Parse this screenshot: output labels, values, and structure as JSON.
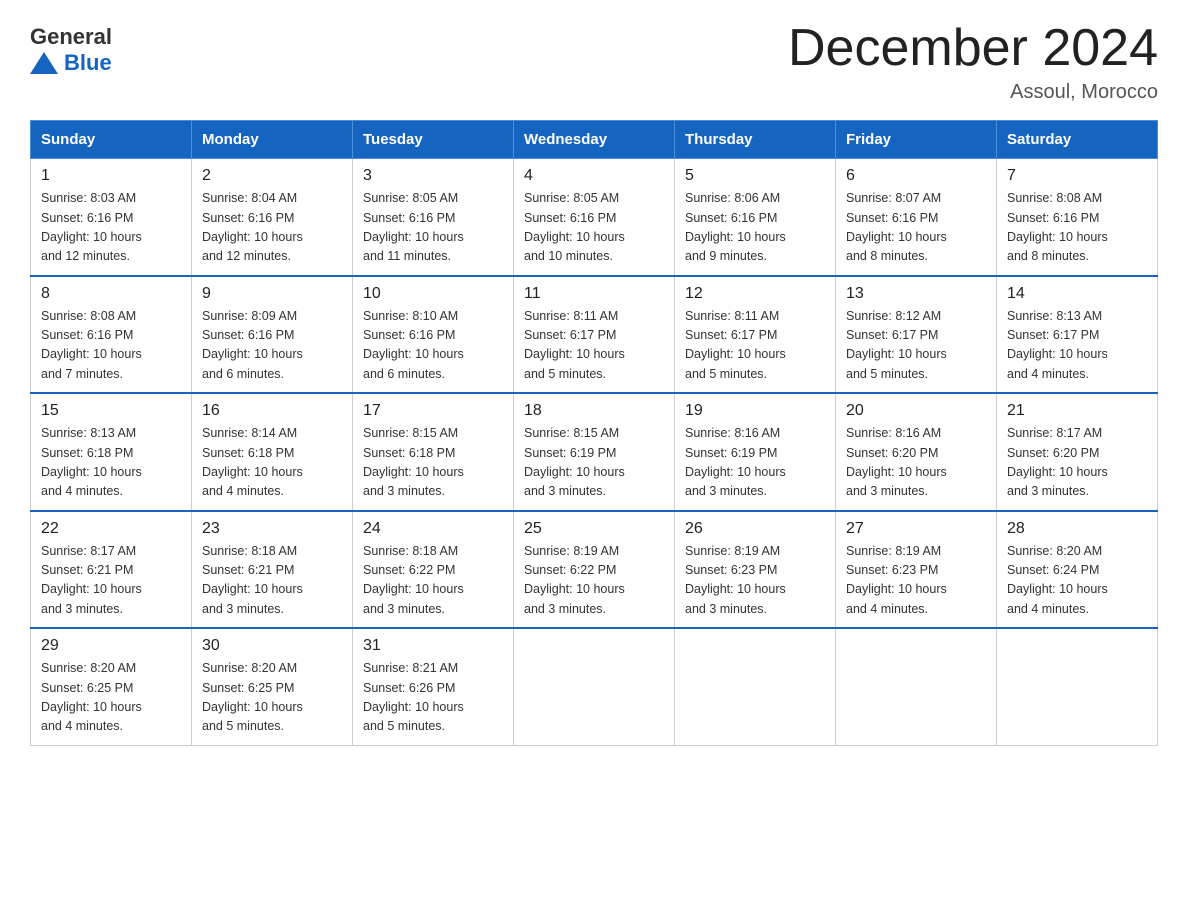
{
  "header": {
    "logo_general": "General",
    "logo_blue": "Blue",
    "title": "December 2024",
    "subtitle": "Assoul, Morocco"
  },
  "days_of_week": [
    "Sunday",
    "Monday",
    "Tuesday",
    "Wednesday",
    "Thursday",
    "Friday",
    "Saturday"
  ],
  "weeks": [
    [
      {
        "day": "1",
        "info": "Sunrise: 8:03 AM\nSunset: 6:16 PM\nDaylight: 10 hours\nand 12 minutes."
      },
      {
        "day": "2",
        "info": "Sunrise: 8:04 AM\nSunset: 6:16 PM\nDaylight: 10 hours\nand 12 minutes."
      },
      {
        "day": "3",
        "info": "Sunrise: 8:05 AM\nSunset: 6:16 PM\nDaylight: 10 hours\nand 11 minutes."
      },
      {
        "day": "4",
        "info": "Sunrise: 8:05 AM\nSunset: 6:16 PM\nDaylight: 10 hours\nand 10 minutes."
      },
      {
        "day": "5",
        "info": "Sunrise: 8:06 AM\nSunset: 6:16 PM\nDaylight: 10 hours\nand 9 minutes."
      },
      {
        "day": "6",
        "info": "Sunrise: 8:07 AM\nSunset: 6:16 PM\nDaylight: 10 hours\nand 8 minutes."
      },
      {
        "day": "7",
        "info": "Sunrise: 8:08 AM\nSunset: 6:16 PM\nDaylight: 10 hours\nand 8 minutes."
      }
    ],
    [
      {
        "day": "8",
        "info": "Sunrise: 8:08 AM\nSunset: 6:16 PM\nDaylight: 10 hours\nand 7 minutes."
      },
      {
        "day": "9",
        "info": "Sunrise: 8:09 AM\nSunset: 6:16 PM\nDaylight: 10 hours\nand 6 minutes."
      },
      {
        "day": "10",
        "info": "Sunrise: 8:10 AM\nSunset: 6:16 PM\nDaylight: 10 hours\nand 6 minutes."
      },
      {
        "day": "11",
        "info": "Sunrise: 8:11 AM\nSunset: 6:17 PM\nDaylight: 10 hours\nand 5 minutes."
      },
      {
        "day": "12",
        "info": "Sunrise: 8:11 AM\nSunset: 6:17 PM\nDaylight: 10 hours\nand 5 minutes."
      },
      {
        "day": "13",
        "info": "Sunrise: 8:12 AM\nSunset: 6:17 PM\nDaylight: 10 hours\nand 5 minutes."
      },
      {
        "day": "14",
        "info": "Sunrise: 8:13 AM\nSunset: 6:17 PM\nDaylight: 10 hours\nand 4 minutes."
      }
    ],
    [
      {
        "day": "15",
        "info": "Sunrise: 8:13 AM\nSunset: 6:18 PM\nDaylight: 10 hours\nand 4 minutes."
      },
      {
        "day": "16",
        "info": "Sunrise: 8:14 AM\nSunset: 6:18 PM\nDaylight: 10 hours\nand 4 minutes."
      },
      {
        "day": "17",
        "info": "Sunrise: 8:15 AM\nSunset: 6:18 PM\nDaylight: 10 hours\nand 3 minutes."
      },
      {
        "day": "18",
        "info": "Sunrise: 8:15 AM\nSunset: 6:19 PM\nDaylight: 10 hours\nand 3 minutes."
      },
      {
        "day": "19",
        "info": "Sunrise: 8:16 AM\nSunset: 6:19 PM\nDaylight: 10 hours\nand 3 minutes."
      },
      {
        "day": "20",
        "info": "Sunrise: 8:16 AM\nSunset: 6:20 PM\nDaylight: 10 hours\nand 3 minutes."
      },
      {
        "day": "21",
        "info": "Sunrise: 8:17 AM\nSunset: 6:20 PM\nDaylight: 10 hours\nand 3 minutes."
      }
    ],
    [
      {
        "day": "22",
        "info": "Sunrise: 8:17 AM\nSunset: 6:21 PM\nDaylight: 10 hours\nand 3 minutes."
      },
      {
        "day": "23",
        "info": "Sunrise: 8:18 AM\nSunset: 6:21 PM\nDaylight: 10 hours\nand 3 minutes."
      },
      {
        "day": "24",
        "info": "Sunrise: 8:18 AM\nSunset: 6:22 PM\nDaylight: 10 hours\nand 3 minutes."
      },
      {
        "day": "25",
        "info": "Sunrise: 8:19 AM\nSunset: 6:22 PM\nDaylight: 10 hours\nand 3 minutes."
      },
      {
        "day": "26",
        "info": "Sunrise: 8:19 AM\nSunset: 6:23 PM\nDaylight: 10 hours\nand 3 minutes."
      },
      {
        "day": "27",
        "info": "Sunrise: 8:19 AM\nSunset: 6:23 PM\nDaylight: 10 hours\nand 4 minutes."
      },
      {
        "day": "28",
        "info": "Sunrise: 8:20 AM\nSunset: 6:24 PM\nDaylight: 10 hours\nand 4 minutes."
      }
    ],
    [
      {
        "day": "29",
        "info": "Sunrise: 8:20 AM\nSunset: 6:25 PM\nDaylight: 10 hours\nand 4 minutes."
      },
      {
        "day": "30",
        "info": "Sunrise: 8:20 AM\nSunset: 6:25 PM\nDaylight: 10 hours\nand 5 minutes."
      },
      {
        "day": "31",
        "info": "Sunrise: 8:21 AM\nSunset: 6:26 PM\nDaylight: 10 hours\nand 5 minutes."
      },
      {
        "day": "",
        "info": ""
      },
      {
        "day": "",
        "info": ""
      },
      {
        "day": "",
        "info": ""
      },
      {
        "day": "",
        "info": ""
      }
    ]
  ]
}
